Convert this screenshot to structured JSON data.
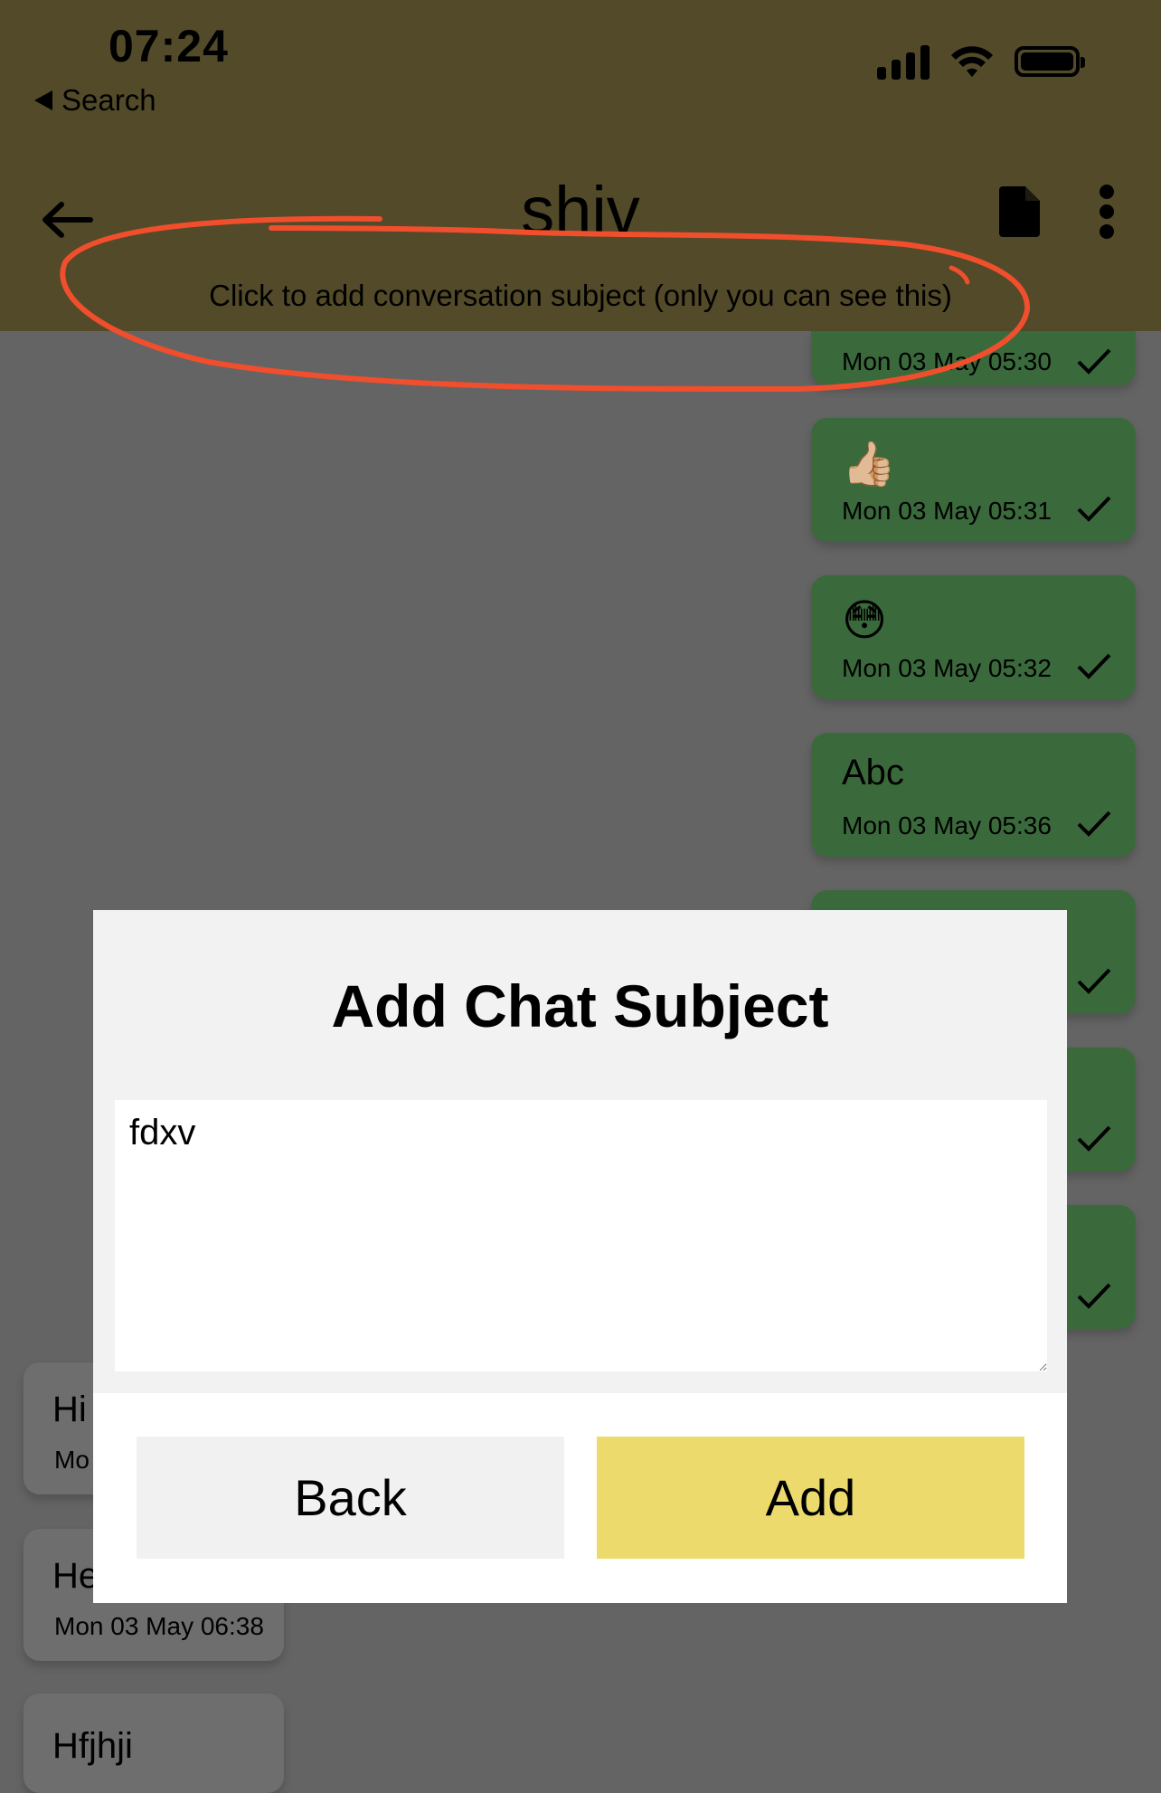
{
  "status_bar": {
    "time": "07:24",
    "back_app": "Search"
  },
  "header": {
    "title": "shiv",
    "subject_prompt": "Click to add conversation subject (only you can see this)",
    "annotation_color": "#f04e2c"
  },
  "messages_out": [
    {
      "body": "",
      "time": "Mon 03 May 05:30"
    },
    {
      "body": "👍🏼",
      "time": "Mon 03 May 05:31"
    },
    {
      "body": "😳",
      "time": "Mon 03 May 05:32"
    },
    {
      "body": "Abc",
      "time": "Mon 03 May 05:36"
    }
  ],
  "messages_in": [
    {
      "body": "Hi",
      "time": "Mo"
    },
    {
      "body": "He",
      "time": "Mon 03 May 06:38"
    },
    {
      "body": "Hfjhji",
      "time": ""
    }
  ],
  "dialog": {
    "title": "Add Chat Subject",
    "input_value": "fdxv",
    "back_label": "Back",
    "add_label": "Add"
  },
  "colors": {
    "header_bg": "#524a28",
    "overlay_bg": "#646464",
    "outgoing_bubble": "#3a6a3b",
    "add_button": "#ecdb6c"
  }
}
